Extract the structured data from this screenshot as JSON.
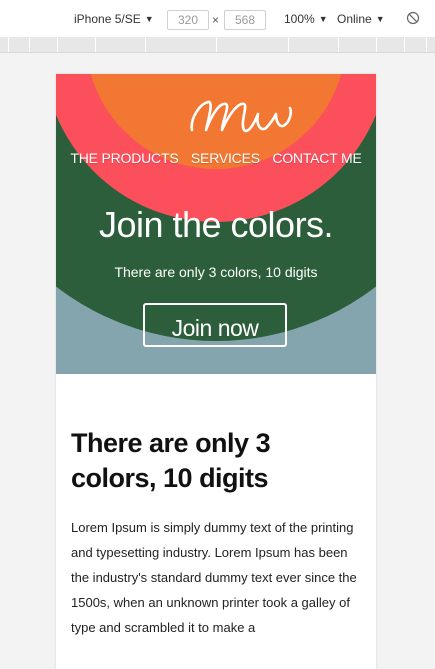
{
  "devtools": {
    "device_name": "iPhone 5/SE",
    "width": "320",
    "height": "568",
    "zoom": "100%",
    "network": "Online",
    "times_symbol": "×",
    "rotate_icon": "rotate-icon"
  },
  "colors": {
    "green": "#2c5e3b",
    "pink": "#fb4f5c",
    "orange": "#f17732",
    "slate": "#84a5ae",
    "white": "#ffffff"
  },
  "site": {
    "logo_text": "Mw",
    "nav": [
      "THE PRODUCTS",
      "SERVICES",
      "CONTACT ME"
    ],
    "hero_title": "Join the colors.",
    "hero_subtitle": "There are only 3 colors, 10 digits",
    "cta_label": "Join now",
    "section_heading": "There are only 3 colors, 10 digits",
    "section_body": "Lorem Ipsum is simply dummy text of the printing and typesetting industry. Lorem Ipsum has been the industry's standard dummy text ever since the 1500s, when an unknown printer took a galley of type and scrambled it to make a"
  }
}
